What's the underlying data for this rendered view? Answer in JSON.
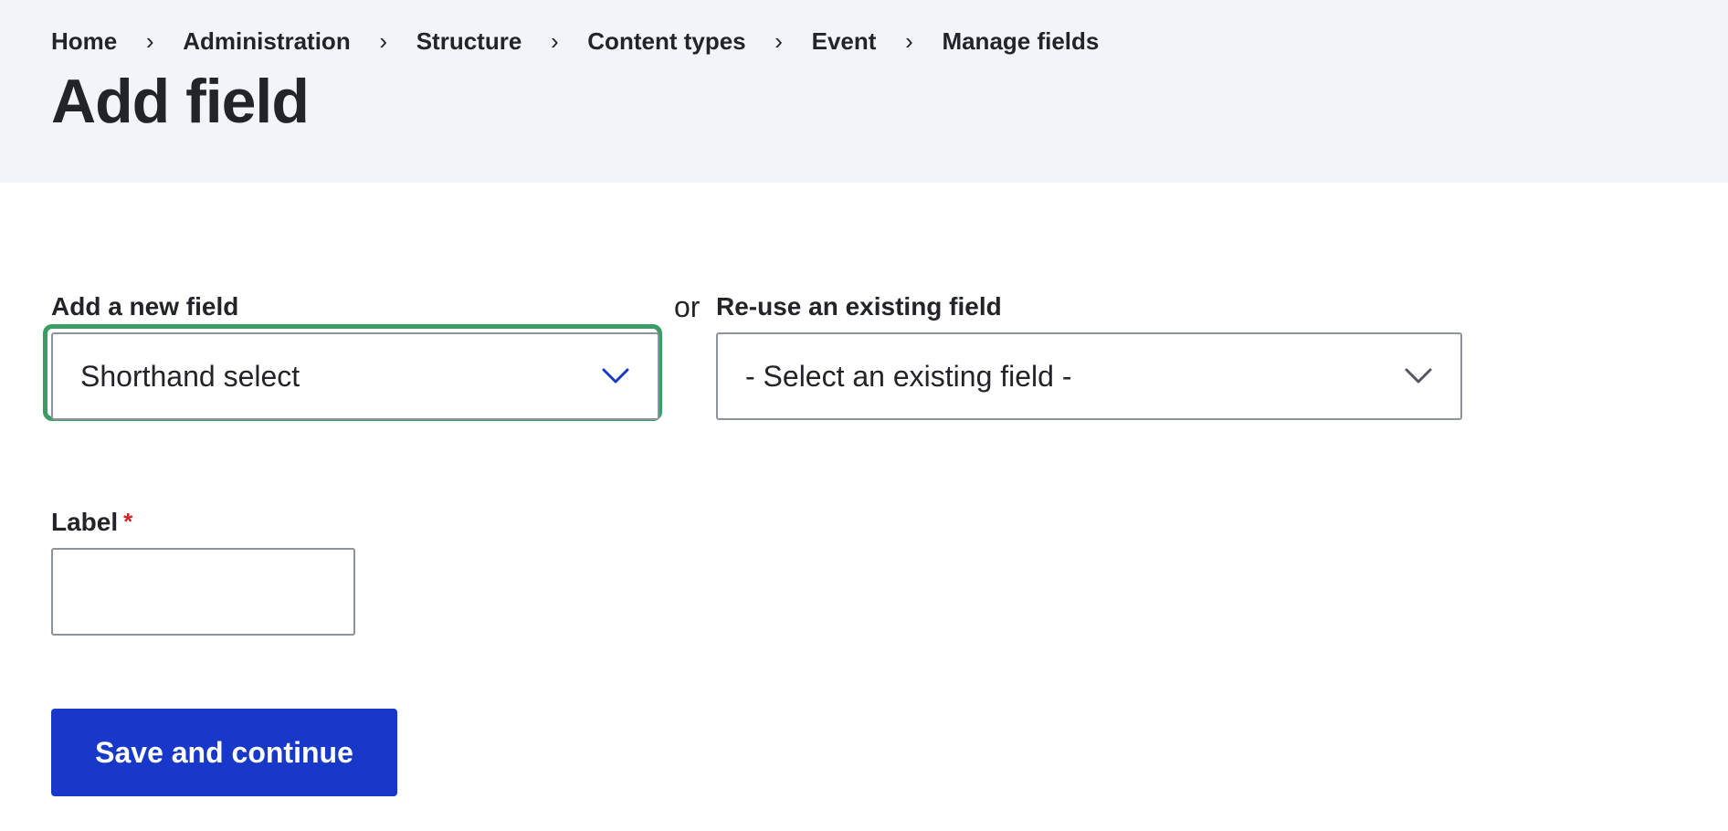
{
  "breadcrumb": [
    {
      "label": "Home"
    },
    {
      "label": "Administration"
    },
    {
      "label": "Structure"
    },
    {
      "label": "Content types"
    },
    {
      "label": "Event"
    },
    {
      "label": "Manage fields"
    }
  ],
  "breadcrumb_separator": "›",
  "page": {
    "title": "Add field"
  },
  "new_field": {
    "label": "Add a new field",
    "selected_value": "Shorthand select",
    "chevron_color": "#1738c9"
  },
  "or_text": "or",
  "existing_field": {
    "label": "Re-use an existing field",
    "selected_value": "- Select an existing field -"
  },
  "label_field": {
    "label": "Label",
    "required_marker": "*",
    "value": ""
  },
  "actions": {
    "save_label": "Save and continue"
  },
  "colors": {
    "header_bg": "#f3f4f9",
    "focus_ring": "#3b9d64",
    "primary": "#1738c9",
    "required": "#d72222"
  },
  "icons": [
    "chevron-right-icon",
    "chevron-down-icon"
  ]
}
